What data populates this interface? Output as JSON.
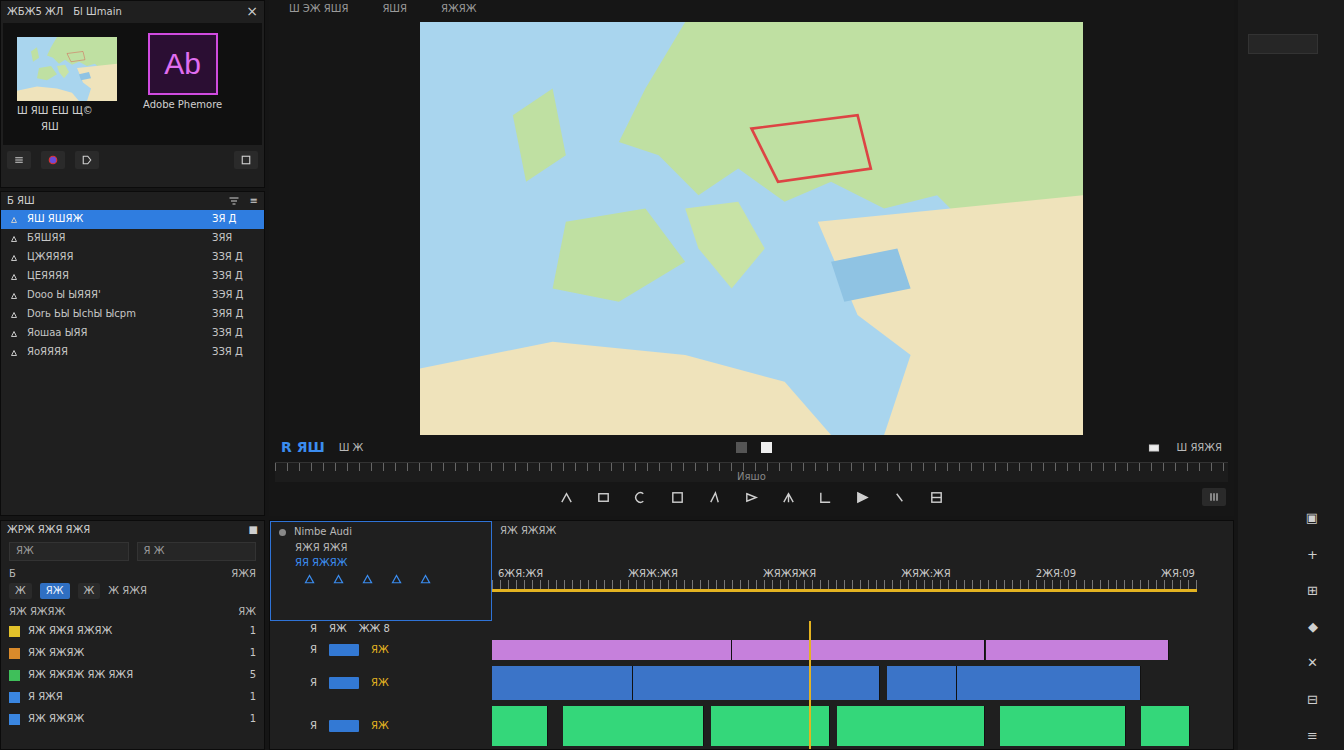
{
  "project_panel": {
    "title": "ЖБЖ5 ЖЛ",
    "subtitle": "Бl Шmain",
    "close": "×",
    "map_caption": "Ш ЯШ   ЕШ Щ©",
    "map_sub": "ЯШ",
    "logo": "Ab",
    "logo_caption": "Adobe Phemore"
  },
  "media_browser": {
    "title": "Б ЯШ",
    "menu": "≡",
    "items": [
      {
        "name": "ЯШ ЯШЯЖ",
        "value": "ЗЯ Д",
        "selected": true
      },
      {
        "name": "БЯШЯЯ",
        "value": "ЗЯЯ",
        "selected": false
      },
      {
        "name": "ЦЖЯЯЯЯ",
        "value": "ЗЗЯ Д",
        "selected": false
      },
      {
        "name": "ЦЕЯЯЯЯ",
        "value": "ЗЗЯ Д",
        "selected": false
      },
      {
        "name": "Dooo Ы ЫЯЯЯ'",
        "value": "ЗЭЯ Д",
        "selected": false
      },
      {
        "name": "Dorь ЬЫ ЫchЫ Ыcpm",
        "value": "ЗЯЯ Д",
        "selected": false
      },
      {
        "name": "Яoшaa ЫЯЯ",
        "value": "ЗЗЯ Д",
        "selected": false
      },
      {
        "name": "ЯoЯЯЯЯ",
        "value": "ЗЗЯ Д",
        "selected": false
      }
    ]
  },
  "monitor": {
    "tabs": [
      "Ш ЭЖ ЯШЯ",
      "ЯШЯ",
      "ЯЖЯЖ"
    ],
    "timecode": "R ЯШ",
    "zoom": "Ш Ж",
    "fit": "Ш ЯЯЖЯ",
    "scrub_label": "Ияшо"
  },
  "effects": {
    "title": "ЖРЖ ЯЖЯ ЯЖЯ",
    "close": "■",
    "search": [
      "ЯЖ",
      "Я Ж"
    ],
    "section": "Б",
    "section_right": "ЯЖЯ",
    "buttons": [
      {
        "label": "Ж",
        "selected": false
      },
      {
        "label": "ЯЖ",
        "selected": true
      },
      {
        "label": "Ж",
        "selected": false
      }
    ],
    "buttons_text": "Ж ЯЖЯ",
    "column": "ЯЖ ЯЖЯЖ",
    "column_right": "ЯЖ",
    "items": [
      {
        "name": "ЯЖ ЯЖЯ ЯЖЯЖ",
        "count": "1",
        "color": "#e2c12a"
      },
      {
        "name": "ЯЖ ЯЖЯЖ",
        "count": "1",
        "color": "#d98a2b"
      },
      {
        "name": "ЯЖ ЯЖЯЖ ЯЖ ЯЖЯ",
        "count": "5",
        "color": "#3fbf5a"
      },
      {
        "name": "Я ЯЖЯ",
        "count": "1",
        "color": "#3a86e0"
      },
      {
        "name": "ЯЖ ЯЖЯЖ",
        "count": "1",
        "color": "#3a86e0"
      }
    ]
  },
  "timeline": {
    "name": "Nimbe Audi",
    "subtitle": "ЯЖЯ ЯЖЯ",
    "label": "ЯЯ ЯЖЯЖ",
    "header": "ЯЖ ЯЖЯЖ",
    "columns": [
      "Я",
      "ЯЖ",
      "ЖЖ 8"
    ],
    "ruler": [
      "6ЖЯ:ЖЯ",
      "ЖЯЖ:ЖЯ",
      "ЖЯЖЯЖЯ",
      "ЖЯЖ:ЖЯ",
      "2ЖЯ:09",
      "ЖЯ:09"
    ],
    "duration": 100,
    "playhead": 45,
    "tracks": [
      {
        "name": "Я",
        "tag": "ЯЖ",
        "on": true,
        "color": "#c680dc",
        "clips": [
          {
            "start": 0,
            "end": 34
          },
          {
            "start": 34,
            "end": 70
          },
          {
            "start": 70,
            "end": 96
          }
        ]
      },
      {
        "name": "Я",
        "tag": "ЯЖ",
        "on": true,
        "color": "#3b74c8",
        "clips": [
          {
            "start": 0,
            "end": 20
          },
          {
            "start": 20,
            "end": 55
          },
          {
            "start": 56,
            "end": 66
          },
          {
            "start": 66,
            "end": 92
          }
        ]
      },
      {
        "name": "Я",
        "tag": "ЯЖ",
        "on": true,
        "color": "#34d77a",
        "clips": [
          {
            "start": 0,
            "end": 8
          },
          {
            "start": 10,
            "end": 30
          },
          {
            "start": 31,
            "end": 48
          },
          {
            "start": 49,
            "end": 70
          },
          {
            "start": 72,
            "end": 90
          },
          {
            "start": 92,
            "end": 99
          }
        ]
      }
    ]
  },
  "right_toolbar": [
    "▣",
    "+",
    "⊞",
    "◆",
    "✕",
    "⊟",
    "≡"
  ]
}
